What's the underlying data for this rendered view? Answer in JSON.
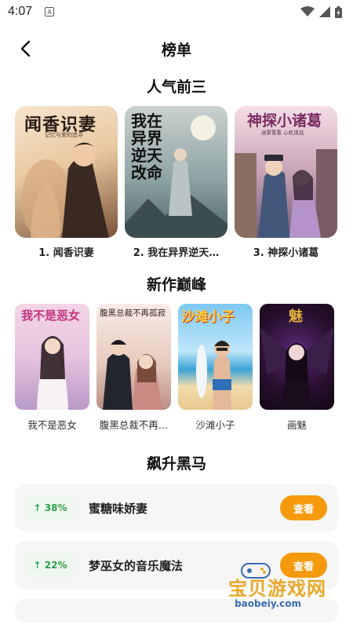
{
  "status": {
    "time": "4:07",
    "badge": "A"
  },
  "header": {
    "title": "榜单"
  },
  "sections": {
    "top3_title": "人气前三",
    "new_title": "新作巅峰",
    "rising_title": "飙升黑马"
  },
  "top3": [
    {
      "label": "1. 闻香识妻",
      "cover_text": "闻香识妻",
      "cover_sub": "记忆与爱的追寻"
    },
    {
      "label": "2. 我在异界逆天…",
      "cover_text": "我在异界逆天改命"
    },
    {
      "label": "3. 神探小诸葛",
      "cover_text": "神探小诸葛",
      "cover_sub": "迷雾重重 心机谍战"
    }
  ],
  "new_works": [
    {
      "label": "我不是恶女",
      "cover_text": "我不是恶女"
    },
    {
      "label": "腹黑总裁不再…",
      "cover_text": "腹黑总裁不再孤寂"
    },
    {
      "label": "沙滩小子",
      "cover_text": "沙滩小子"
    },
    {
      "label": "画魅",
      "cover_text": "魅"
    }
  ],
  "rising": [
    {
      "pct": "↑ 38%",
      "name": "蜜糖味娇妻",
      "btn": "查看"
    },
    {
      "pct": "↑ 22%",
      "name": "梦巫女的音乐魔法",
      "btn": "查看"
    }
  ],
  "watermark": {
    "text": "宝贝游戏网",
    "url": "baobeiy.com"
  },
  "colors": {
    "accent": "#f59a0c",
    "up": "#2e9e4a"
  }
}
